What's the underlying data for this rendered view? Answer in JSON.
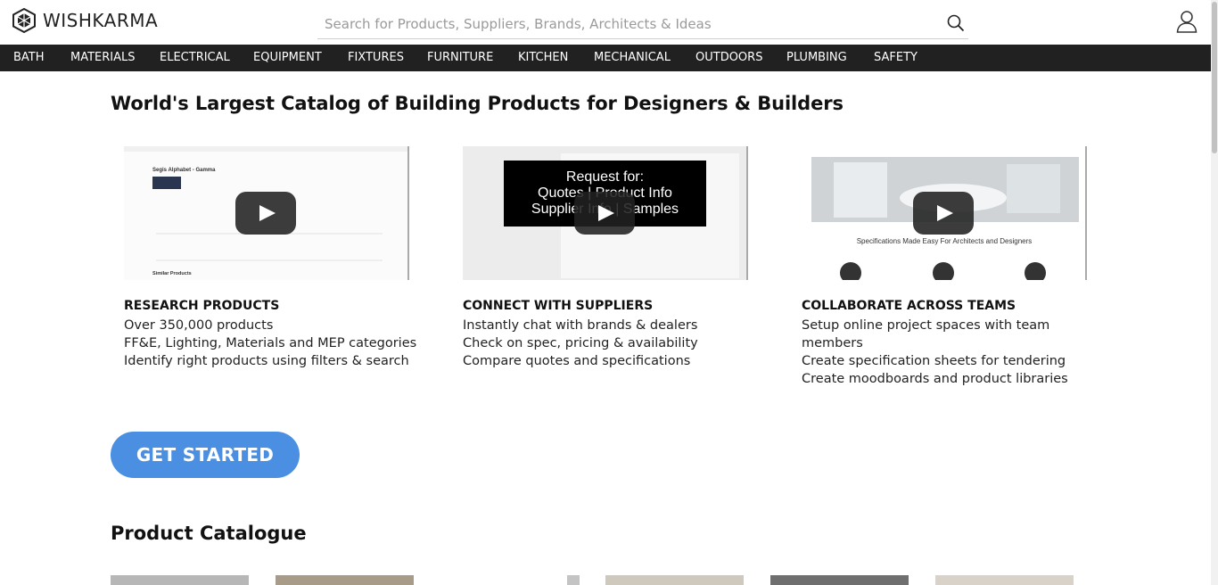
{
  "brand": {
    "name": "WISHKARMA"
  },
  "search": {
    "placeholder": "Search for Products, Suppliers, Brands, Architects & Ideas",
    "icon": "search-icon"
  },
  "nav": {
    "items": [
      "BATH",
      "MATERIALS",
      "ELECTRICAL",
      "EQUIPMENT",
      "FIXTURES",
      "FURNITURE",
      "KITCHEN",
      "MECHANICAL",
      "OUTDOORS",
      "PLUMBING",
      "SAFETY"
    ]
  },
  "hero": {
    "title": "World's Largest Catalog of Building Products for Designers & Builders"
  },
  "videos": [
    {
      "caption_title": "Segis Alphabet - Gamma",
      "heading": "Similar Products"
    },
    {
      "overlay_lines": [
        "Request for:",
        "Quotes | Product Info",
        "Supplier Info | Samples"
      ]
    },
    {
      "caption": "Specifications Made Easy For Architects and Designers"
    }
  ],
  "features": [
    {
      "title": "RESEARCH PRODUCTS",
      "lines": [
        "Over 350,000 products",
        "FF&E, Lighting, Materials and MEP categories",
        "Identify right products using filters & search"
      ]
    },
    {
      "title": "CONNECT WITH SUPPLIERS",
      "lines": [
        "Instantly chat with brands & dealers",
        "Check on spec, pricing & availability",
        "Compare quotes and specifications"
      ]
    },
    {
      "title": "COLLABORATE ACROSS TEAMS",
      "lines": [
        "Setup online project spaces with team",
        "members",
        "Create specification sheets for tendering",
        "Create moodboards and product libraries"
      ]
    }
  ],
  "cta": {
    "label": "GET STARTED"
  },
  "catalogue": {
    "title": "Product Catalogue"
  },
  "colors": {
    "nav_bg": "#212121",
    "cta": "#4a8fe1",
    "text": "#111111"
  }
}
